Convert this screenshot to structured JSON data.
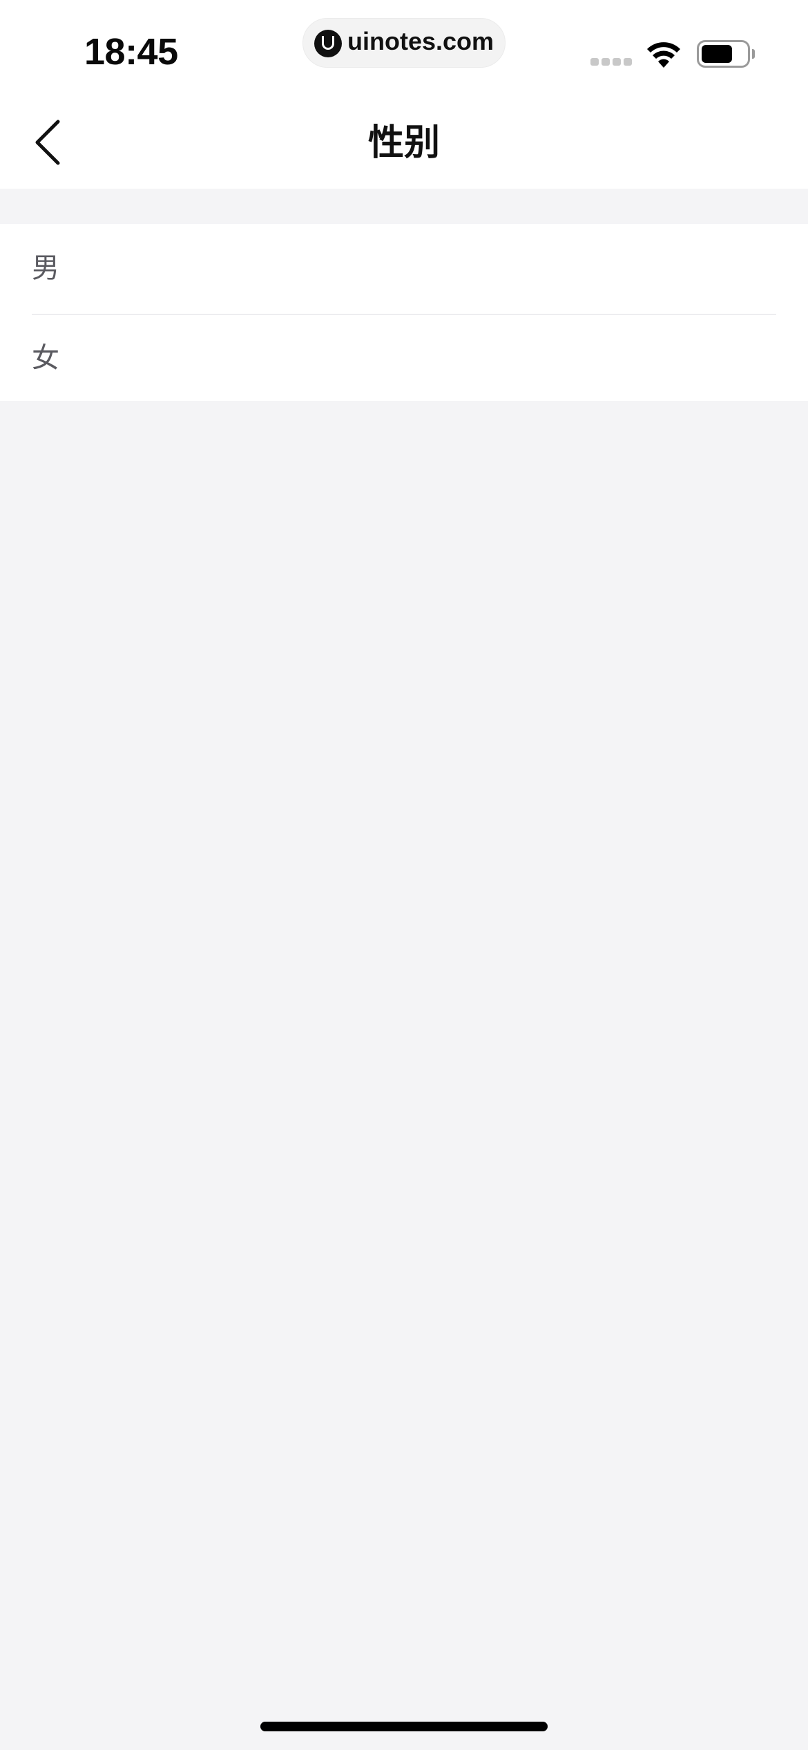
{
  "status_bar": {
    "time": "18:45",
    "watermark": "uinotes.com"
  },
  "nav": {
    "title": "性别",
    "back_icon": "chevron-left-icon"
  },
  "options": [
    {
      "label": "男"
    },
    {
      "label": "女"
    }
  ],
  "colors": {
    "background": "#f4f4f6",
    "surface": "#ffffff",
    "title_text": "#111111",
    "option_text": "#5a5a60",
    "divider": "#ededf0"
  }
}
